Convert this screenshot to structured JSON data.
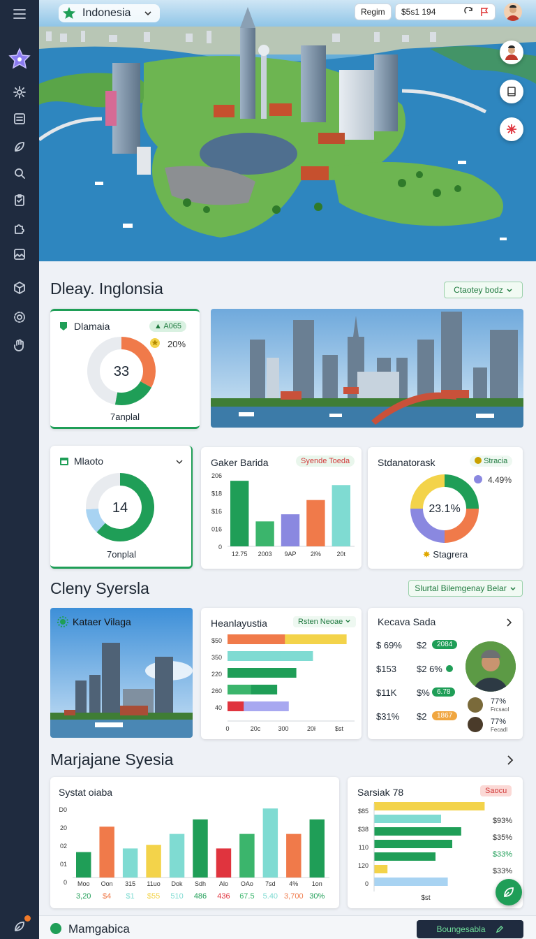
{
  "topbar": {
    "country": "Indonesia",
    "region_button": "Regim",
    "price_field": "$5s1 194"
  },
  "sections": {
    "s1_title": "Dleay. Inglonsia",
    "s1_chip": "Ctaotey bodz",
    "s2_title": "Cleny Syersla",
    "s2_chip": "Slurtal Bilemgenay Belar",
    "s3_title": "Marjajane Syesia",
    "footer_title": "Mamgabica",
    "footer_button": "Boungesabla"
  },
  "card_a": {
    "title": "Dlamaia",
    "badge": "A065",
    "sub_value": "20%",
    "center": "33",
    "caption": "7anplal"
  },
  "card_b": {
    "title": "Mlaoto",
    "center": "14",
    "caption": "7onplal"
  },
  "card_c": {
    "title": "Gaker Barida",
    "badge": "Syende Toeda",
    "yticks": [
      "206",
      "$18",
      "$16",
      "016",
      "0"
    ],
    "xticks": [
      "12.75",
      "2003",
      "9AP",
      "2l%",
      "20t"
    ]
  },
  "card_d": {
    "title": "Stdanatorask",
    "badge": "Stracia",
    "legend_value": "4.49%",
    "center": "23.1%",
    "caption": "Stagrera"
  },
  "card_e": {
    "title": "Kataer Vilaga"
  },
  "card_f": {
    "title": "Heanlayustia",
    "badge": "Rsten Neoae",
    "yticks": [
      "$50",
      "350",
      "220",
      "260",
      "40"
    ],
    "xticks": [
      "0",
      "20c",
      "300",
      "20ł",
      "$st"
    ]
  },
  "card_g": {
    "title": "Kecava Sada",
    "rows": [
      {
        "a": "$ 69%",
        "b": "$2",
        "tag": "2084"
      },
      {
        "a": "$153",
        "b": "$2 6%",
        "tag": ""
      },
      {
        "a": "$11K",
        "b": "$%",
        "tag": "6.78"
      },
      {
        "a": "$31%",
        "b": "$2",
        "tag": "1867"
      }
    ],
    "avatar_lines": [
      "77%",
      "Frcsaol",
      "77%",
      "Fecadl"
    ]
  },
  "card_h": {
    "title": "Systat oiaba",
    "yticks": [
      "D0",
      "20",
      "02",
      "01",
      "0"
    ],
    "categories": [
      "Moo",
      "Oon",
      "315",
      "11uo",
      "Dok",
      "Sdh",
      "Alo",
      "OAo",
      "7sd",
      "4%",
      "1on"
    ],
    "values": [
      "3,20",
      "$4",
      "$1",
      "$55",
      "510",
      "486",
      "436",
      "67.5",
      "5.40",
      "3,700",
      "30%"
    ]
  },
  "card_i": {
    "title": "Sarsiak 78",
    "badge": "Saocu",
    "yticks": [
      "$85",
      "$38",
      "110",
      "120",
      "0"
    ],
    "right_values": [
      "$93%",
      "$35%",
      "$33%",
      "$33%"
    ],
    "xlabel": "$st"
  },
  "chart_data": [
    {
      "type": "pie",
      "title": "Dlamaia",
      "values": [
        33,
        20,
        47
      ],
      "colors": [
        "#f07a4a",
        "#1f9e57",
        "#e8ebef"
      ]
    },
    {
      "type": "pie",
      "title": "Mlaoto",
      "values": [
        62,
        12,
        26
      ],
      "colors": [
        "#1f9e57",
        "#a8d3f2",
        "#e8ebef"
      ]
    },
    {
      "type": "bar",
      "title": "Gaker Barida",
      "categories": [
        "12.75",
        "2003",
        "9AP",
        "2l%",
        "20t"
      ],
      "values": [
        0.92,
        0.35,
        0.45,
        0.65,
        0.86
      ],
      "colors": [
        "#1f9e57",
        "#3bb56c",
        "#8a88e0",
        "#f07a4a",
        "#7fdbd2"
      ]
    },
    {
      "type": "pie",
      "title": "Stdanatorask",
      "values": [
        25,
        25,
        25,
        25
      ],
      "colors": [
        "#1f9e57",
        "#f07a4a",
        "#8a88e0",
        "#f3d34a"
      ]
    },
    {
      "type": "bar",
      "title": "Heanlayustia",
      "values": [
        0.78,
        0.72,
        0.58,
        0.32,
        0.22
      ],
      "second": [
        0.52,
        0.12,
        0.0,
        0.22,
        0.38
      ],
      "colors": [
        "#f07a4a",
        "#7fdbd2",
        "#1f9e57",
        "#3bb56c",
        "#e0343e"
      ],
      "colors2": [
        "#f3d34a",
        "#7fdbd2",
        "#1f9e57",
        "#1f9e57",
        "#a8a8f0"
      ]
    },
    {
      "type": "bar",
      "title": "Systat oiaba",
      "categories": [
        "Moo",
        "Oon",
        "315",
        "11uo",
        "Dok",
        "Sdh",
        "Alo",
        "OAo",
        "7sd",
        "4%",
        "1on"
      ],
      "values": [
        0.35,
        0.7,
        0.4,
        0.45,
        0.6,
        0.8,
        0.4,
        0.6,
        0.95,
        0.6,
        0.8
      ],
      "colors": [
        "#1f9e57",
        "#f07a4a",
        "#7fdbd2",
        "#f3d34a",
        "#7fdbd2",
        "#1f9e57",
        "#e0343e",
        "#3bb56c",
        "#7fdbd2",
        "#f07a4a",
        "#1f9e57"
      ]
    },
    {
      "type": "bar",
      "title": "Sarsiak 78",
      "values": [
        0.99,
        0.6,
        0.78,
        0.7,
        0.55,
        0.12,
        0.66
      ],
      "colors": [
        "#f3d34a",
        "#7fdbd2",
        "#1f9e57",
        "#1f9e57",
        "#1f9e57",
        "#f3d34a",
        "#a8d3f2"
      ]
    }
  ]
}
